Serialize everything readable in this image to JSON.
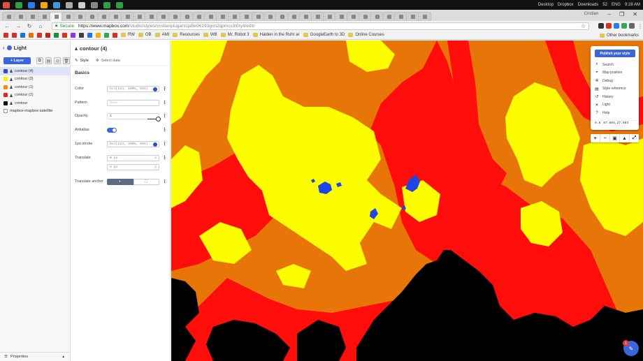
{
  "taskbar": {
    "desktop_label": "Desktop",
    "dropbox_label": "Dropbox",
    "downloads_label": "Downloads",
    "battery_label": "52",
    "lang_label": "ENG",
    "clock": "9:28 AM",
    "app_colors": [
      "#e84c3d",
      "#2f9e44",
      "#2b7de9",
      "#f3a712",
      "#3a9bd8",
      "#aaaaaa",
      "#cccccc",
      "#888888",
      "#2f9e44",
      "#2f9e44"
    ]
  },
  "browser": {
    "user_name": "Cristian",
    "tab_count": 36,
    "active_tab_index": 4
  },
  "address": {
    "secure_label": "Secure",
    "url_host": "https://www.mapbox.com",
    "url_path": "/studio/styles/cristianplugari/cja5e96193gnn2qpmcs3l0ry4/edit/"
  },
  "bookmarks": {
    "items": [
      {
        "label": "",
        "color": "#d93025"
      },
      {
        "label": "",
        "color": "#d93025"
      },
      {
        "label": "",
        "color": "#1a73e8"
      },
      {
        "label": "",
        "color": "#e8710a"
      },
      {
        "label": "",
        "color": "#d93025"
      },
      {
        "label": "",
        "color": "#c5221f"
      },
      {
        "label": "",
        "color": "#1e8e3e"
      },
      {
        "label": "",
        "color": "#d93025"
      },
      {
        "label": "",
        "color": "#9334e6"
      },
      {
        "label": "",
        "color": "#3c4043"
      },
      {
        "label": "",
        "color": "#1a73e8"
      },
      {
        "label": "",
        "color": "#f9ab00"
      },
      {
        "label": "",
        "color": "#34a853"
      },
      {
        "label": "",
        "color": "#d93025"
      }
    ],
    "folders": [
      "RW",
      "OB",
      "AMI",
      "Resources",
      "WB",
      "Mr. Robot 3",
      "Halden in the Ruhr ar",
      "GoogleEarth to 3D",
      "Online Courses"
    ],
    "other_label": "Other bookmarks"
  },
  "layers_panel": {
    "style_name": "Light",
    "add_layer_label": "+ Layer",
    "layers": [
      {
        "name": "contour (4)",
        "color": "#2a4fc9",
        "selected": true
      },
      {
        "name": "contour (3)",
        "color": "#f7f200",
        "selected": false
      },
      {
        "name": "contour (1)",
        "color": "#f28a0b",
        "selected": false
      },
      {
        "name": "contour (2)",
        "color": "#e8201c",
        "selected": false
      },
      {
        "name": "contour",
        "color": "#111111",
        "selected": false
      },
      {
        "name": "mapbox-mapbox-satellite",
        "color": "#cccccc",
        "selected": false
      }
    ],
    "properties_label": "Properties"
  },
  "properties_panel": {
    "layer_title": "contour (4)",
    "tab_style": "Style",
    "tab_select_data": "Select data",
    "section": "Basics",
    "color_label": "Color",
    "color_value": "hsl(224, 100%, 55%)",
    "pattern_label": "Pattern",
    "pattern_placeholder": "None",
    "opacity_label": "Opacity",
    "opacity_value": "1",
    "antialias_label": "Antialias",
    "stroke_label": "1px stroke",
    "stroke_value": "hsl(224, 100%, 55%)",
    "translate_label": "Translate",
    "translate_x": "0 px",
    "translate_x_axis": "x",
    "translate_y": "0 px",
    "translate_y_axis": "y",
    "anchor_label": "Translate anchor"
  },
  "map_menu": {
    "publish_label": "Publish your style",
    "items": [
      {
        "label": "Search",
        "icon": "search-icon"
      },
      {
        "label": "Map position",
        "icon": "crosshair-icon"
      },
      {
        "label": "Debug",
        "icon": "debug-icon"
      },
      {
        "label": "Style reference",
        "icon": "book-icon"
      },
      {
        "label": "History",
        "icon": "history-icon"
      },
      {
        "label": "Light",
        "icon": "sun-icon"
      },
      {
        "label": "Help",
        "icon": "help-icon"
      }
    ],
    "zoom": "9.8",
    "coords": "87.694,27.993"
  },
  "help": {
    "badge": "1"
  },
  "colors": {
    "accent": "#3a66d8",
    "contour_black": "#000000",
    "contour_red": "#fe0d0a",
    "contour_orange": "#e87508",
    "contour_yellow": "#fefd00",
    "contour_blue": "#1f45e6"
  }
}
